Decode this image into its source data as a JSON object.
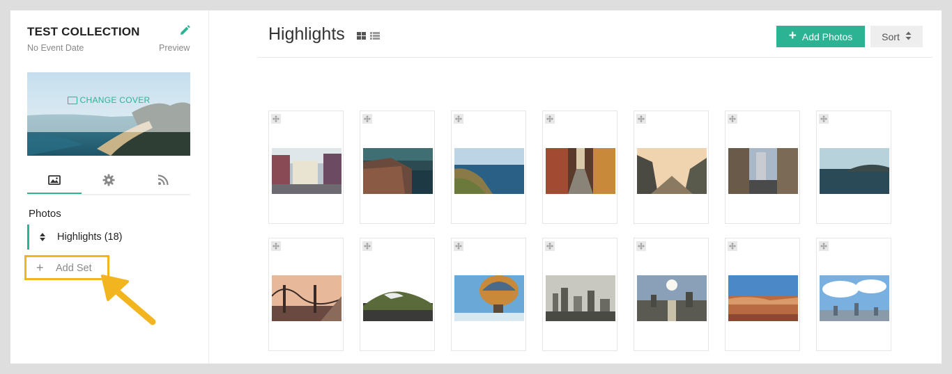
{
  "sidebar": {
    "collection_title": "TEST COLLECTION",
    "event_date": "No Event Date",
    "preview_label": "Preview",
    "change_cover_label": "CHANGE COVER",
    "tabs": [
      {
        "icon": "image-icon"
      },
      {
        "icon": "gear-icon"
      },
      {
        "icon": "rss-icon"
      }
    ],
    "photos_heading": "Photos",
    "sets": [
      {
        "label": "Highlights (18)"
      }
    ],
    "add_set_label": "Add Set"
  },
  "main": {
    "title": "Highlights",
    "add_photos_label": "Add Photos",
    "sort_label": "Sort"
  },
  "colors": {
    "accent": "#2bb394",
    "highlight": "#f2b51f"
  },
  "photos": [
    {
      "subject": "colorful street with buildings"
    },
    {
      "subject": "cliffside village at dusk"
    },
    {
      "subject": "coastal cliff and sea"
    },
    {
      "subject": "narrow old town alley"
    },
    {
      "subject": "mountain valley at sunset"
    },
    {
      "subject": "city street with tall buildings"
    },
    {
      "subject": "lake with mountains"
    },
    {
      "subject": "golden gate bridge at sunset"
    },
    {
      "subject": "snowy hill"
    },
    {
      "subject": "hot air balloon"
    },
    {
      "subject": "foggy city skyline"
    },
    {
      "subject": "city skyline with sun"
    },
    {
      "subject": "desert canyon landscape"
    },
    {
      "subject": "city skyline with clouds"
    }
  ]
}
